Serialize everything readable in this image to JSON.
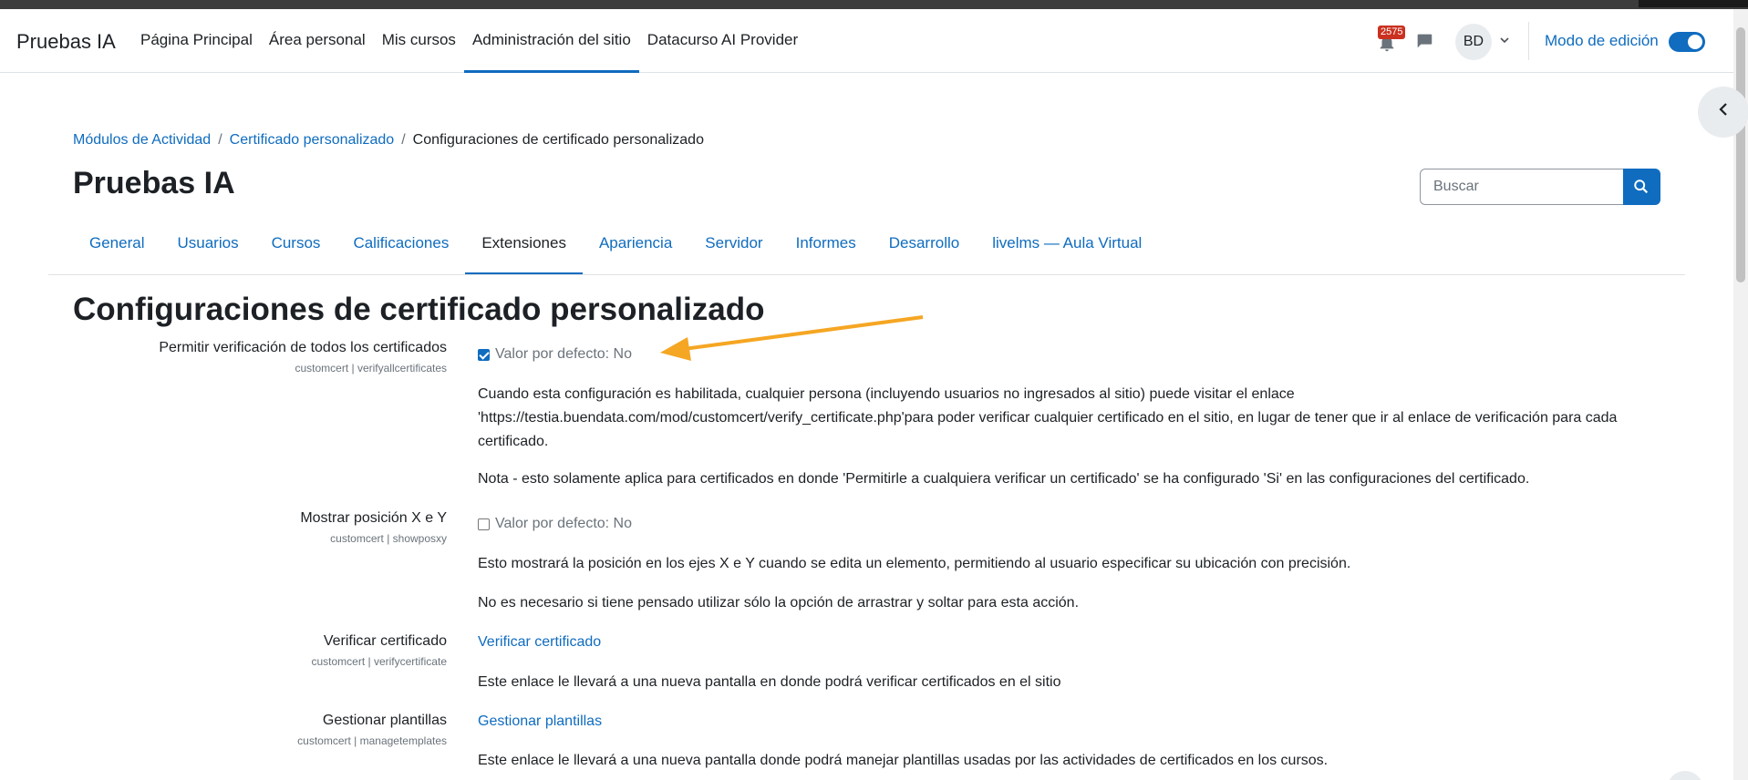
{
  "navbar": {
    "brand": "Pruebas IA",
    "items": [
      {
        "label": "Página Principal"
      },
      {
        "label": "Área personal"
      },
      {
        "label": "Mis cursos"
      },
      {
        "label": "Administración del sitio"
      },
      {
        "label": "Datacurso AI Provider"
      }
    ],
    "active_item": "Administración del sitio",
    "notification_count": "2575",
    "avatar_initials": "BD",
    "edit_mode_label": "Modo de edición",
    "edit_mode_on": true
  },
  "breadcrumb": [
    {
      "label": "Módulos de Actividad"
    },
    {
      "label": "Certificado personalizado"
    },
    {
      "label": "Configuraciones de certificado personalizado"
    }
  ],
  "page_title": "Pruebas IA",
  "search": {
    "placeholder": "Buscar"
  },
  "tabs": [
    {
      "label": "General"
    },
    {
      "label": "Usuarios"
    },
    {
      "label": "Cursos"
    },
    {
      "label": "Calificaciones"
    },
    {
      "label": "Extensiones"
    },
    {
      "label": "Apariencia"
    },
    {
      "label": "Servidor"
    },
    {
      "label": "Informes"
    },
    {
      "label": "Desarrollo"
    },
    {
      "label": "livelms — Aula Virtual"
    }
  ],
  "active_tab": "Extensiones",
  "section_title": "Configuraciones de certificado personalizado",
  "settings": {
    "verifyall": {
      "label": "Permitir verificación de todos los certificados",
      "key": "customcert | verifyallcertificates",
      "checked": true,
      "default_text": "Valor por defecto: No",
      "desc1": "Cuando esta configuración es habilitada, cualquier persona (incluyendo usuarios no ingresados al sitio) puede visitar el enlace 'https://testia.buendata.com/mod/customcert/verify_certificate.php'para poder verificar cualquier certificado en el sitio, en lugar de tener que ir al enlace de verificación para cada certificado.",
      "desc2": "Nota - esto solamente aplica para certificados en donde 'Permitirle a cualquiera verificar un certificado' se ha configurado 'Si' en las configuraciones del certificado."
    },
    "showposxy": {
      "label": "Mostrar posición X e Y",
      "key": "customcert | showposxy",
      "checked": false,
      "default_text": "Valor por defecto: No",
      "desc1": "Esto mostrará la posición en los ejes X e Y cuando se edita un elemento, permitiendo al usuario especificar su ubicación con precisión.",
      "desc2": "No es necesario si tiene pensado utilizar sólo la opción de arrastrar y soltar para esta acción."
    },
    "verifycertificate": {
      "label": "Verificar certificado",
      "key": "customcert | verifycertificate",
      "link": "Verificar certificado",
      "desc": "Este enlace le llevará a una nueva pantalla en donde podrá verificar certificados en el sitio"
    },
    "managetemplates": {
      "label": "Gestionar plantillas",
      "key": "customcert | managetemplates",
      "link": "Gestionar plantillas",
      "desc": "Este enlace le llevará a una nueva pantalla donde podrá manejar plantillas usadas por las actividades de certificados en los cursos."
    }
  },
  "colors": {
    "primary": "#0f6cbf",
    "text": "#1d2125",
    "muted": "#6a737b",
    "badge": "#ca3120",
    "annotation_arrow": "#f5a623"
  },
  "icons": [
    "bell-icon",
    "chat-icon",
    "chevron-down-icon",
    "chevron-left-icon",
    "search-icon",
    "arrow-annotation-icon"
  ]
}
